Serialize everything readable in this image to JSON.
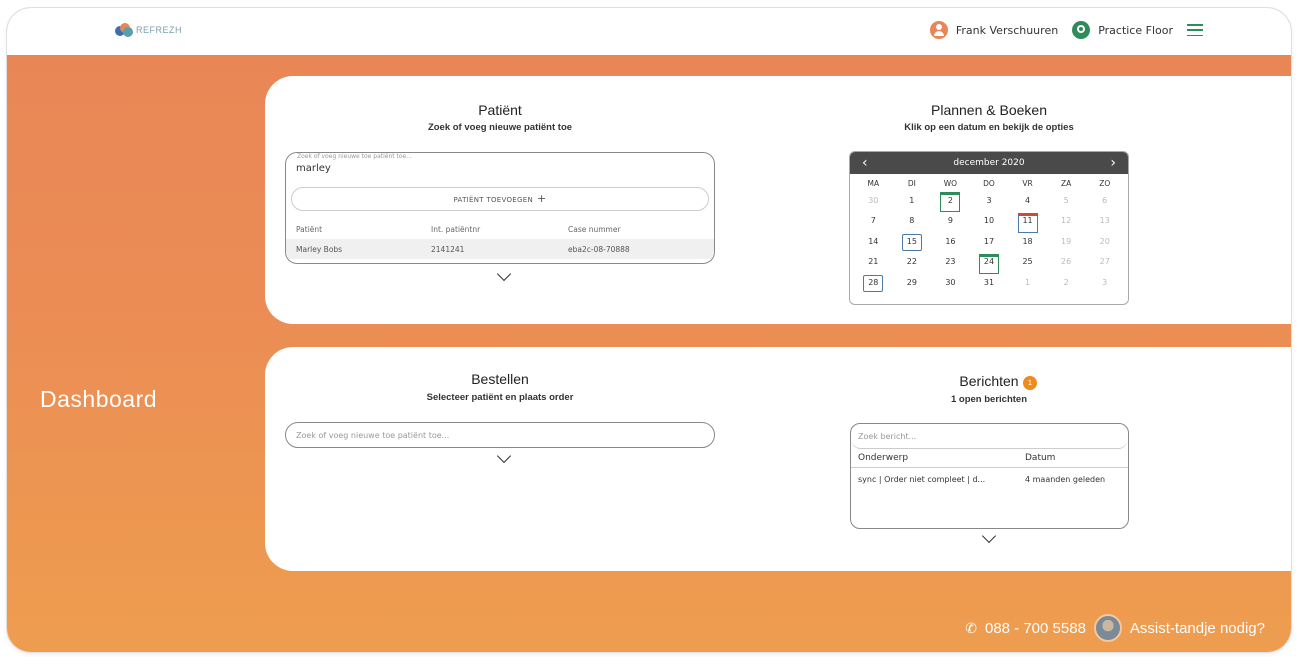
{
  "brand": {
    "logo_text": "REFREZH"
  },
  "header": {
    "user_name": "Frank Verschuuren",
    "location": "Practice Floor"
  },
  "sidebar": {
    "title": "Dashboard"
  },
  "patient": {
    "title": "Patiënt",
    "subtitle": "Zoek of voeg nieuwe patiënt toe",
    "search_label": "Zoek of voeg nieuwe toe patiënt toe...",
    "search_value": "marley",
    "add_button": "PATIËNT TOEVOEGEN",
    "columns": [
      "Patiënt",
      "Int. patiëntnr",
      "Case nummer"
    ],
    "rows": [
      [
        "Marley Bobs",
        "2141241",
        "eba2c-08-70888"
      ]
    ]
  },
  "planning": {
    "title": "Plannen & Boeken",
    "subtitle": "Klik op een datum en bekijk de opties",
    "month": "december 2020",
    "weekdays": [
      "MA",
      "DI",
      "WO",
      "DO",
      "VR",
      "ZA",
      "ZO"
    ],
    "days": [
      "30",
      "1",
      "2",
      "3",
      "4",
      "5",
      "6",
      "7",
      "8",
      "9",
      "10",
      "11",
      "12",
      "13",
      "14",
      "15",
      "16",
      "17",
      "18",
      "19",
      "20",
      "21",
      "22",
      "23",
      "24",
      "25",
      "26",
      "27",
      "28",
      "29",
      "30",
      "31",
      "1",
      "2",
      "3"
    ]
  },
  "order": {
    "title": "Bestellen",
    "subtitle": "Selecteer patiënt en plaats order",
    "search_placeholder": "Zoek of voeg nieuwe toe patiënt toe..."
  },
  "messages": {
    "title": "Berichten",
    "badge_count": "1",
    "subtitle": "1 open berichten",
    "search_placeholder": "Zoek bericht...",
    "col_subject": "Onderwerp",
    "col_date": "Datum",
    "rows": [
      {
        "subject": "sync | Order niet compleet | d...",
        "date": "4 maanden geleden"
      }
    ]
  },
  "footer": {
    "phone": "088 - 700 5588",
    "assist": "Assist-tandje nodig?"
  },
  "colors": {
    "brand_orange": "#e98556",
    "accent_green": "#2e8c5a",
    "calendar_header": "#4a4a4a"
  }
}
